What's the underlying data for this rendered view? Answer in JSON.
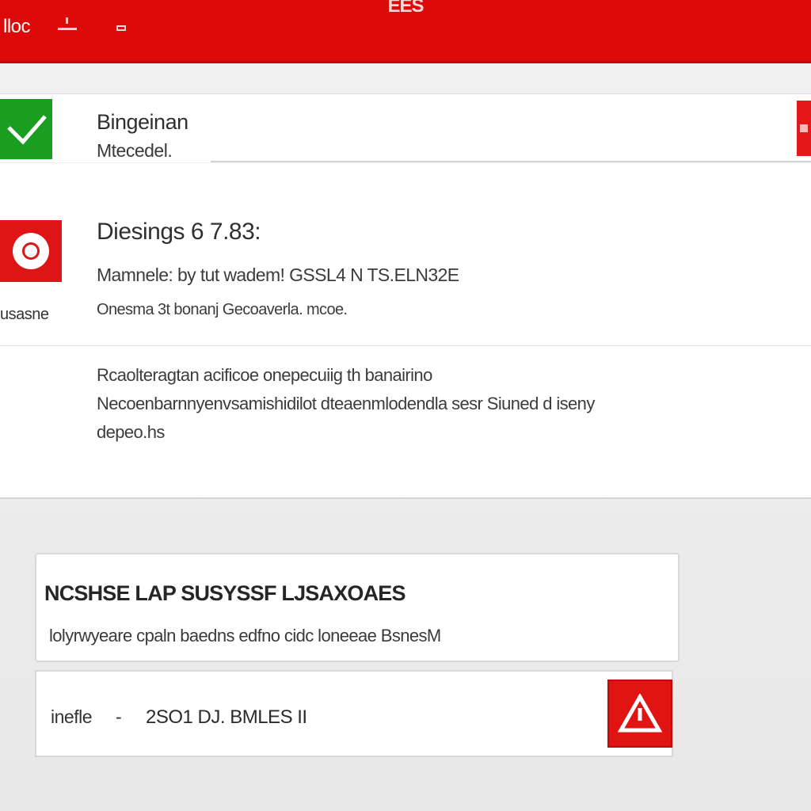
{
  "colors": {
    "accent_red": "#dd0a0a",
    "success_green": "#1a9e22",
    "panel_white": "#ffffff",
    "background": "#ececec"
  },
  "window": {
    "app_label": "lloc",
    "title": "EES",
    "minimize_icon": "minus-icon",
    "maximize_icon": "square-icon"
  },
  "status_item": {
    "icon": "check-icon",
    "title": "Bingeinan",
    "subtitle": "Mtecedel.",
    "side_badge_icon": "flag-icon"
  },
  "alert_item": {
    "icon": "alert-circle-icon",
    "icon_caption": "usasne",
    "title": "Diesings 6 7.83:",
    "line1": "Mamnele: by tut wadem! GSSL4 N TS.ELN32E",
    "line2": "Onesma 3t bonanj Gecoaverla. mcoe."
  },
  "description": {
    "line1": "Rcaolteragtan acificoe onepecuiig th banairino",
    "line2": "Necoenbarnnyenvsamishidilot dteaenmlodendla sesr Siuned d iseny",
    "line3": "depeo.hs"
  },
  "card_info": {
    "title": "NCSHSE LAP SUSYSSF LJSAXOAES",
    "body": "lolyrwyeare cpaln baedns edfno cidc loneeae BsnesM"
  },
  "card_action": {
    "label": "inefle",
    "separator": "-",
    "value": "2SO1 DJ. BMLES II",
    "button_icon": "warning-triangle-icon"
  }
}
